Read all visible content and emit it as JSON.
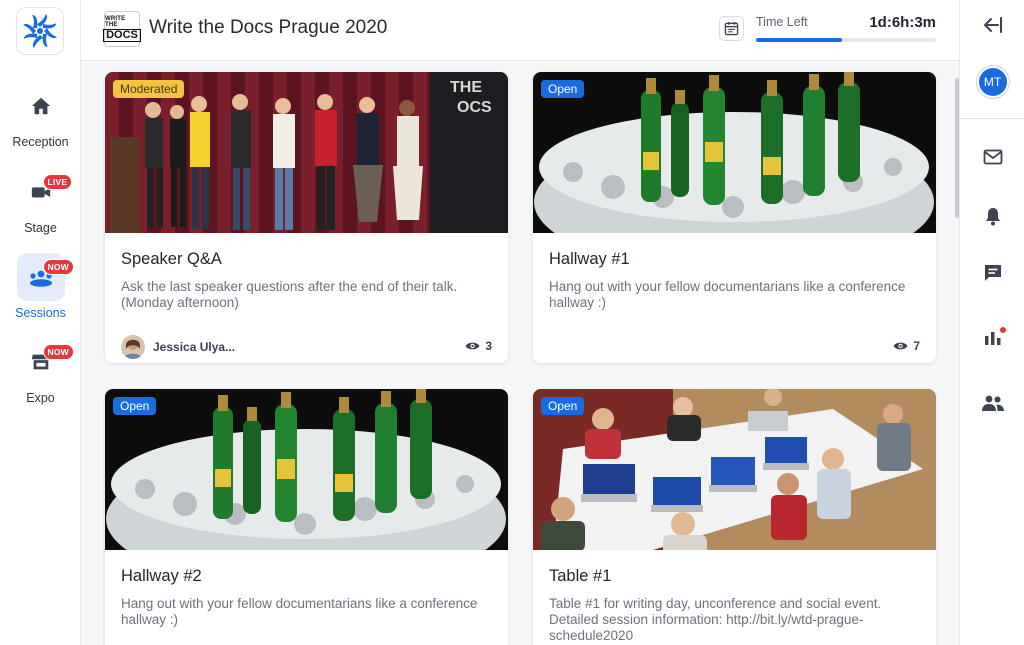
{
  "nav": {
    "items": [
      {
        "label": "Reception",
        "icon": "home-icon",
        "badge": ""
      },
      {
        "label": "Stage",
        "icon": "video-camera-icon",
        "badge": "LIVE"
      },
      {
        "label": "Sessions",
        "icon": "people-group-icon",
        "badge": "NOW"
      },
      {
        "label": "Expo",
        "icon": "booth-icon",
        "badge": "NOW"
      }
    ]
  },
  "header": {
    "logo_line1": "WRITE THE",
    "logo_line2": "DOCS",
    "title": "Write the Docs Prague 2020",
    "time_left_label": "Time Left",
    "time_left_value": "1d:6h:3m",
    "progress": 0.48
  },
  "right_nav": {
    "avatar_initials": "MT",
    "icons": [
      "collapse-arrow-icon",
      "mail-icon",
      "bell-icon",
      "chat-icon",
      "poll-chart-icon",
      "people-icon"
    ]
  },
  "cards": [
    {
      "tag": "Moderated",
      "title": "Speaker Q&A",
      "description": "Ask the last speaker questions after the end of their talk. (Monday afternoon)",
      "speaker": "Jessica Ulya...",
      "viewers": "3",
      "image": "group-photo"
    },
    {
      "tag": "Open",
      "title": "Hallway #1",
      "description": "Hang out with your fellow documentarians like a conference hallway :)",
      "speaker": "",
      "viewers": "7",
      "image": "bottles-on-ice"
    },
    {
      "tag": "Open",
      "title": "Hallway #2",
      "description": "Hang out with your fellow documentarians like a conference hallway :)",
      "speaker": "",
      "viewers": "",
      "image": "bottles-on-ice"
    },
    {
      "tag": "Open",
      "title": "Table #1",
      "description": "Table #1 for writing day, unconference and social event. Detailed session information: http://bit.ly/wtd-prague-schedule2020",
      "speaker": "",
      "viewers": "",
      "image": "people-at-laptops"
    }
  ],
  "colors": {
    "accent": "#1a6be0",
    "badge_red": "#e0393e",
    "moderated_yellow": "#f4c443"
  }
}
